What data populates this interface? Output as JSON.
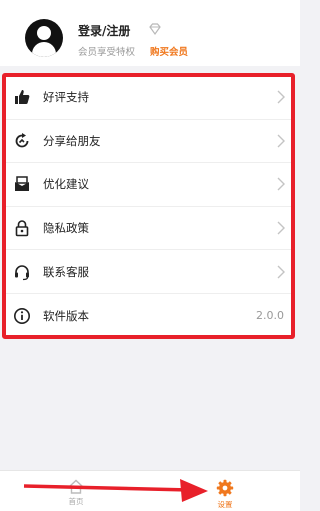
{
  "profile": {
    "login_title": "登录/注册",
    "member_subtitle": "会员享受特权",
    "buy_vip_label": "购买会员"
  },
  "settings": {
    "items": [
      {
        "label": "好评支持",
        "icon": "thumbs-up-icon"
      },
      {
        "label": "分享给朋友",
        "icon": "share-icon"
      },
      {
        "label": "优化建议",
        "icon": "feedback-icon"
      },
      {
        "label": "隐私政策",
        "icon": "lock-icon"
      },
      {
        "label": "联系客服",
        "icon": "headset-icon"
      },
      {
        "label": "软件版本",
        "icon": "info-icon",
        "value": "2.0.0"
      }
    ]
  },
  "bottom_nav": {
    "tabs": [
      {
        "label": "首页",
        "icon": "home-icon",
        "active": false
      },
      {
        "label": "设置",
        "icon": "gear-icon",
        "active": true
      }
    ]
  },
  "colors": {
    "accent": "#f0781e",
    "highlight": "#e8202a"
  }
}
